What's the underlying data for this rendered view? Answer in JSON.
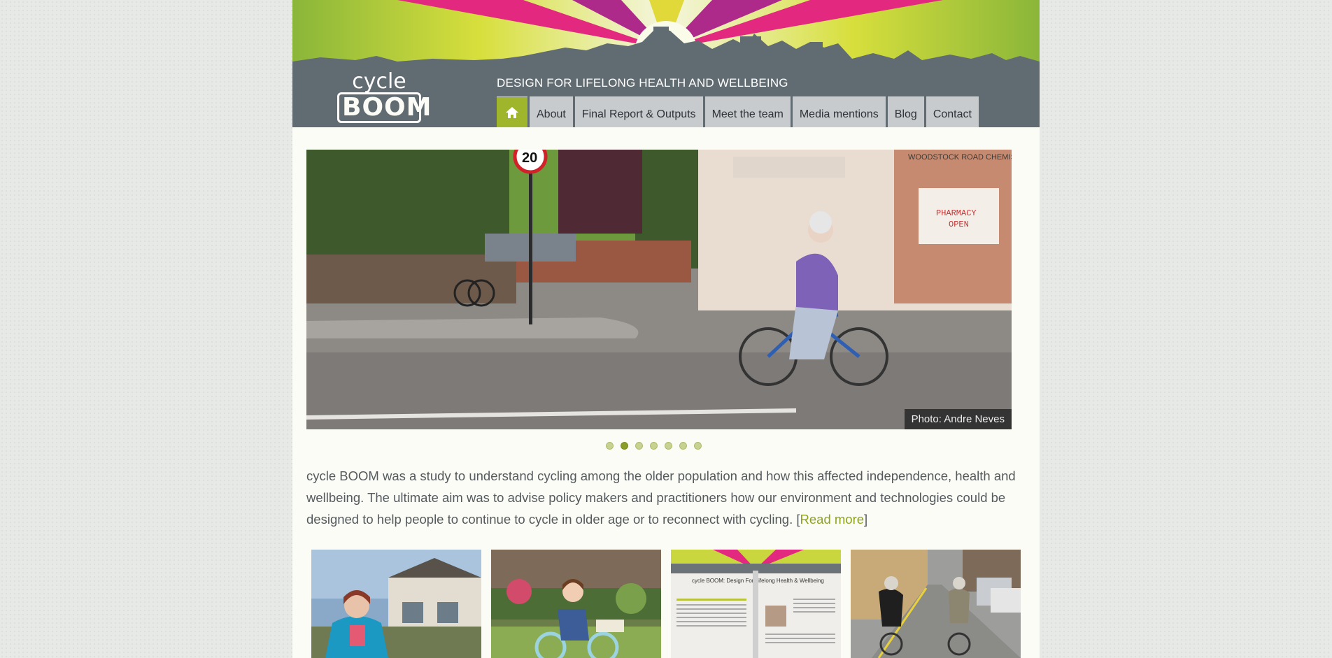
{
  "header": {
    "logo_top": "cycle",
    "logo_bottom": "BOOM",
    "tagline": "DESIGN FOR LIFELONG HEALTH AND WELLBEING",
    "nav": [
      {
        "icon": "home-icon"
      },
      {
        "label": "About"
      },
      {
        "label": "Final Report & Outputs"
      },
      {
        "label": "Meet the team"
      },
      {
        "label": "Media mentions"
      },
      {
        "label": "Blog"
      },
      {
        "label": "Contact"
      }
    ]
  },
  "slider": {
    "caption": "Photo: Andre Neves",
    "sign_speed": "20",
    "shop_name": "WOODSTOCK ROAD CHEMIST",
    "shop_notice_1": "PHARMACY",
    "shop_notice_2": "OPEN",
    "dots_count": 7,
    "active_dot": 1
  },
  "intro": {
    "text": "cycle BOOM was a study to understand cycling among the older population and how this affected independence, health and wellbeing. The ultimate aim was to advise policy makers and practitioners how our environment and technologies could be designed to help people to continue to cycle in older age or to reconnect with cycling. [",
    "link": "Read more",
    "end": "]"
  },
  "thumbnails": [
    {
      "icon": "woman-with-bike-photo"
    },
    {
      "icon": "child-on-bike-photo"
    },
    {
      "icon": "report-brochure-photo",
      "title": "cycle BOOM: Design For Lifelong Health & Wellbeing"
    },
    {
      "icon": "two-cyclists-photo"
    }
  ],
  "colors": {
    "accent": "#9fb52b",
    "nav_bg": "#c8cbce",
    "header_band": "#616b72",
    "link": "#8fa220"
  }
}
